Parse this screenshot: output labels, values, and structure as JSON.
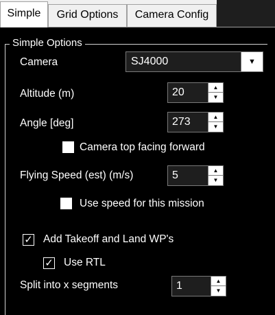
{
  "tabs": [
    {
      "label": "Simple",
      "active": true
    },
    {
      "label": "Grid Options",
      "active": false
    },
    {
      "label": "Camera Config",
      "active": false
    }
  ],
  "group": {
    "title": "Simple Options"
  },
  "camera": {
    "label": "Camera",
    "value": "SJ4000"
  },
  "altitude": {
    "label": "Altitude (m)",
    "value": "20"
  },
  "angle": {
    "label": "Angle [deg]",
    "value": "273"
  },
  "camera_top_forward": {
    "label": "Camera top facing forward",
    "checked": false
  },
  "flying_speed": {
    "label": "Flying Speed (est) (m/s)",
    "value": "5"
  },
  "use_speed": {
    "label": "Use speed for this mission",
    "checked": false
  },
  "takeoff_land": {
    "label": "Add Takeoff and Land WP's",
    "checked": true
  },
  "use_rtl": {
    "label": "Use RTL",
    "checked": true
  },
  "split_segments": {
    "label": "Split into x segments",
    "value": "1"
  },
  "icons": {
    "dropdown": "chevron-down-icon",
    "spin_up": "triangle-up-icon",
    "spin_down": "triangle-down-icon",
    "check": "checkmark-icon"
  }
}
